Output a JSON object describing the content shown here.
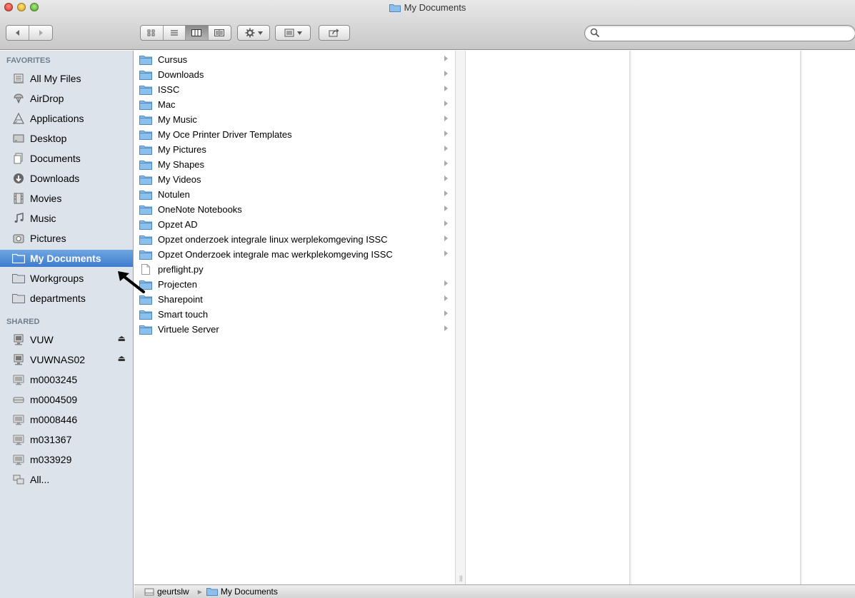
{
  "window": {
    "title": "My Documents"
  },
  "search": {
    "value": "",
    "placeholder": ""
  },
  "sidebar": {
    "favorites_header": "FAVORITES",
    "favorites": [
      {
        "label": "All My Files",
        "icon": "all-files-icon"
      },
      {
        "label": "AirDrop",
        "icon": "airdrop-icon"
      },
      {
        "label": "Applications",
        "icon": "applications-icon"
      },
      {
        "label": "Desktop",
        "icon": "desktop-icon"
      },
      {
        "label": "Documents",
        "icon": "documents-icon"
      },
      {
        "label": "Downloads",
        "icon": "downloads-icon"
      },
      {
        "label": "Movies",
        "icon": "movies-icon"
      },
      {
        "label": "Music",
        "icon": "music-icon"
      },
      {
        "label": "Pictures",
        "icon": "pictures-icon"
      },
      {
        "label": "My Documents",
        "icon": "folder-icon",
        "selected": true
      },
      {
        "label": "Workgroups",
        "icon": "folder-icon"
      },
      {
        "label": "departments",
        "icon": "folder-icon"
      }
    ],
    "shared_header": "SHARED",
    "shared": [
      {
        "label": "VUW",
        "icon": "server-icon",
        "eject": true
      },
      {
        "label": "VUWNAS02",
        "icon": "server-icon",
        "eject": true
      },
      {
        "label": "m0003245",
        "icon": "computer-icon"
      },
      {
        "label": "m0004509",
        "icon": "drive-icon"
      },
      {
        "label": "m0008446",
        "icon": "computer-icon"
      },
      {
        "label": "m031367",
        "icon": "computer-icon"
      },
      {
        "label": "m033929",
        "icon": "computer-icon"
      },
      {
        "label": "All...",
        "icon": "network-icon"
      }
    ]
  },
  "files": [
    {
      "name": "Cursus",
      "type": "folder"
    },
    {
      "name": "Downloads",
      "type": "folder"
    },
    {
      "name": "ISSC",
      "type": "folder"
    },
    {
      "name": "Mac",
      "type": "folder"
    },
    {
      "name": "My Music",
      "type": "folder"
    },
    {
      "name": "My Oce Printer Driver Templates",
      "type": "folder"
    },
    {
      "name": "My Pictures",
      "type": "folder"
    },
    {
      "name": "My Shapes",
      "type": "folder"
    },
    {
      "name": "My Videos",
      "type": "folder"
    },
    {
      "name": "Notulen",
      "type": "folder"
    },
    {
      "name": "OneNote Notebooks",
      "type": "folder"
    },
    {
      "name": "Opzet AD",
      "type": "folder"
    },
    {
      "name": "Opzet onderzoek integrale linux werplekomgeving ISSC",
      "type": "folder"
    },
    {
      "name": "Opzet Onderzoek integrale mac werkplekomgeving ISSC",
      "type": "folder"
    },
    {
      "name": "preflight.py",
      "type": "file"
    },
    {
      "name": "Projecten",
      "type": "folder"
    },
    {
      "name": "Sharepoint",
      "type": "folder"
    },
    {
      "name": "Smart touch",
      "type": "folder"
    },
    {
      "name": "Virtuele Server",
      "type": "folder"
    }
  ],
  "pathbar": {
    "user": "geurtslw",
    "folder": "My Documents"
  },
  "colors": {
    "selection": "#3d7bcf",
    "sidebar_bg": "#dde3ea",
    "folder_blue": "#7fb6e6"
  }
}
